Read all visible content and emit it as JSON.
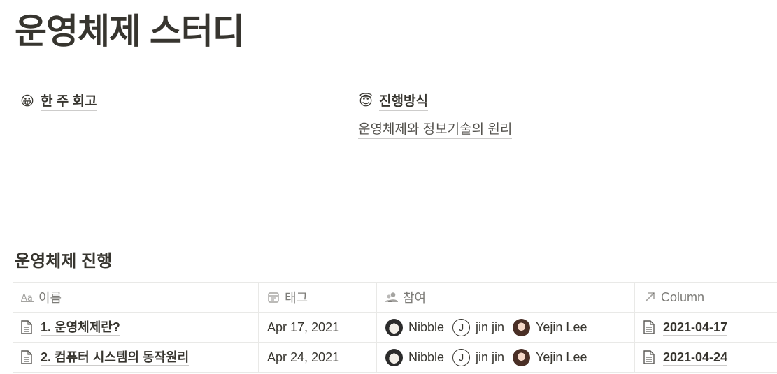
{
  "page": {
    "title": "운영체제 스터디"
  },
  "links": {
    "left": {
      "emoji": "😀",
      "label": "한 주 회고"
    },
    "right": {
      "emoji": "😇",
      "label": "진행방식",
      "sub_link": "운영체제와 정보기술의 원리"
    }
  },
  "database": {
    "title": "운영체제 진행",
    "columns": [
      {
        "label": "이름",
        "icon": "title-aa-icon"
      },
      {
        "label": "태그",
        "icon": "calendar-icon"
      },
      {
        "label": "참여",
        "icon": "people-icon"
      },
      {
        "label": "Column",
        "icon": "arrow-up-right-icon"
      }
    ],
    "rows": [
      {
        "name": "1. 운영체제란?",
        "date": "Apr 17, 2021",
        "people": [
          {
            "name": "Nibble",
            "avatar": "panda-avatar"
          },
          {
            "name": "jin jin",
            "avatar": "letter-avatar",
            "initial": "J"
          },
          {
            "name": "Yejin Lee",
            "avatar": "photo-avatar"
          }
        ],
        "column": "2021-04-17"
      },
      {
        "name": "2. 컴퓨터 시스템의 동작원리",
        "date": "Apr 24, 2021",
        "people": [
          {
            "name": "Nibble",
            "avatar": "panda-avatar"
          },
          {
            "name": "jin jin",
            "avatar": "letter-avatar",
            "initial": "J"
          },
          {
            "name": "Yejin Lee",
            "avatar": "photo-avatar"
          }
        ],
        "column": "2021-04-24"
      }
    ]
  }
}
